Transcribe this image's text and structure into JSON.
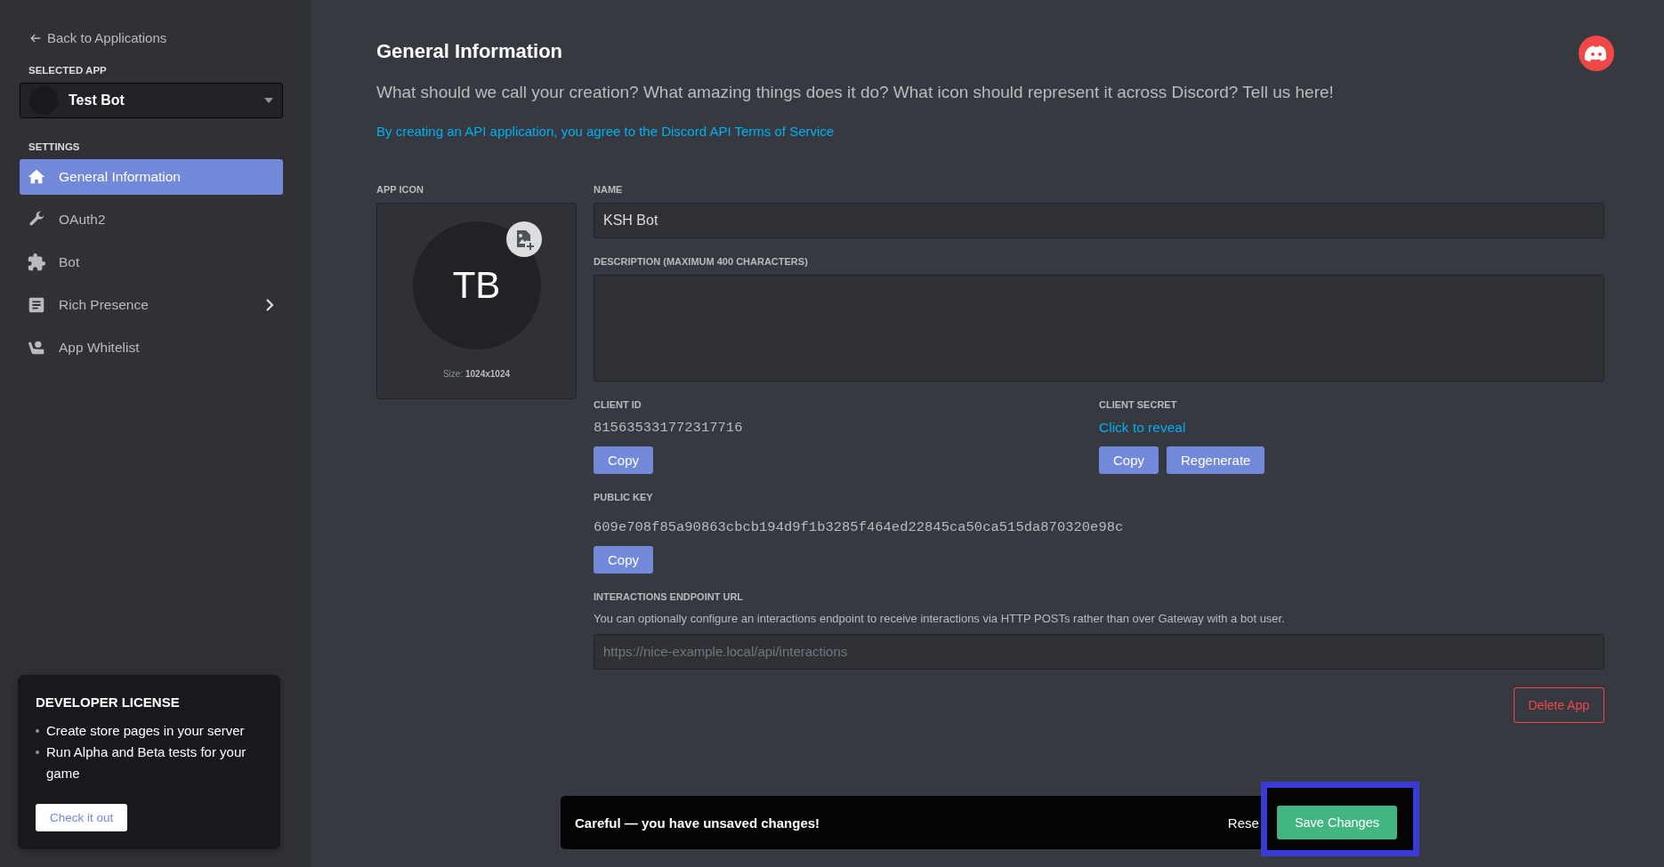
{
  "sidebar": {
    "back_link": "Back to Applications",
    "selected_app_label": "SELECTED APP",
    "selected_app": "Test Bot",
    "settings_label": "SETTINGS",
    "items": [
      {
        "label": "General Information",
        "selected": true,
        "has_submenu": false
      },
      {
        "label": "OAuth2",
        "selected": false,
        "has_submenu": false
      },
      {
        "label": "Bot",
        "selected": false,
        "has_submenu": false
      },
      {
        "label": "Rich Presence",
        "selected": false,
        "has_submenu": true
      },
      {
        "label": "App Whitelist",
        "selected": false,
        "has_submenu": false
      }
    ]
  },
  "developer_license": {
    "title": "DEVELOPER LICENSE",
    "bullets": [
      "Create store pages in your server",
      "Run Alpha and Beta tests for your game"
    ],
    "button": "Check it out"
  },
  "page": {
    "title": "General Information",
    "subtitle": "What should we call your creation? What amazing things does it do? What icon should represent it across Discord? Tell us here!",
    "terms_link": "By creating an API application, you agree to the Discord API Terms of Service"
  },
  "app_icon": {
    "label": "APP ICON",
    "initials": "TB",
    "size": "Size: **1024x1024**"
  },
  "name": {
    "label": "NAME",
    "value": "KSH Bot"
  },
  "description": {
    "label": "DESCRIPTION (MAXIMUM 400 CHARACTERS)"
  },
  "client_id": {
    "label": "CLIENT ID",
    "value": "815635331772317716",
    "buttons": [
      "Copy"
    ]
  },
  "client_secret": {
    "label": "CLIENT SECRET",
    "reveal_link": "Click to reveal",
    "buttons": [
      "Copy",
      "Regenerate"
    ]
  },
  "public_key": {
    "label": "PUBLIC KEY",
    "value": "609e708f85a90863cbcb194d9f1b3285f464ed22845ca50ca515da870320e98c",
    "buttons": [
      "Copy"
    ]
  },
  "interactions_endpoint": {
    "label": "INTERACTIONS ENDPOINT URL",
    "help": "You can optionally configure an interactions endpoint to receive interactions via HTTP POSTs rather than over Gateway with a bot user.",
    "placeholder": "https://nice-example.local/api/interactions"
  },
  "delete_button": "Delete App",
  "unsaved_bar": {
    "message": "Careful — you have unsaved changes!",
    "reset": "Rese",
    "save": "Save Changes",
    "highlighted": true
  }
}
